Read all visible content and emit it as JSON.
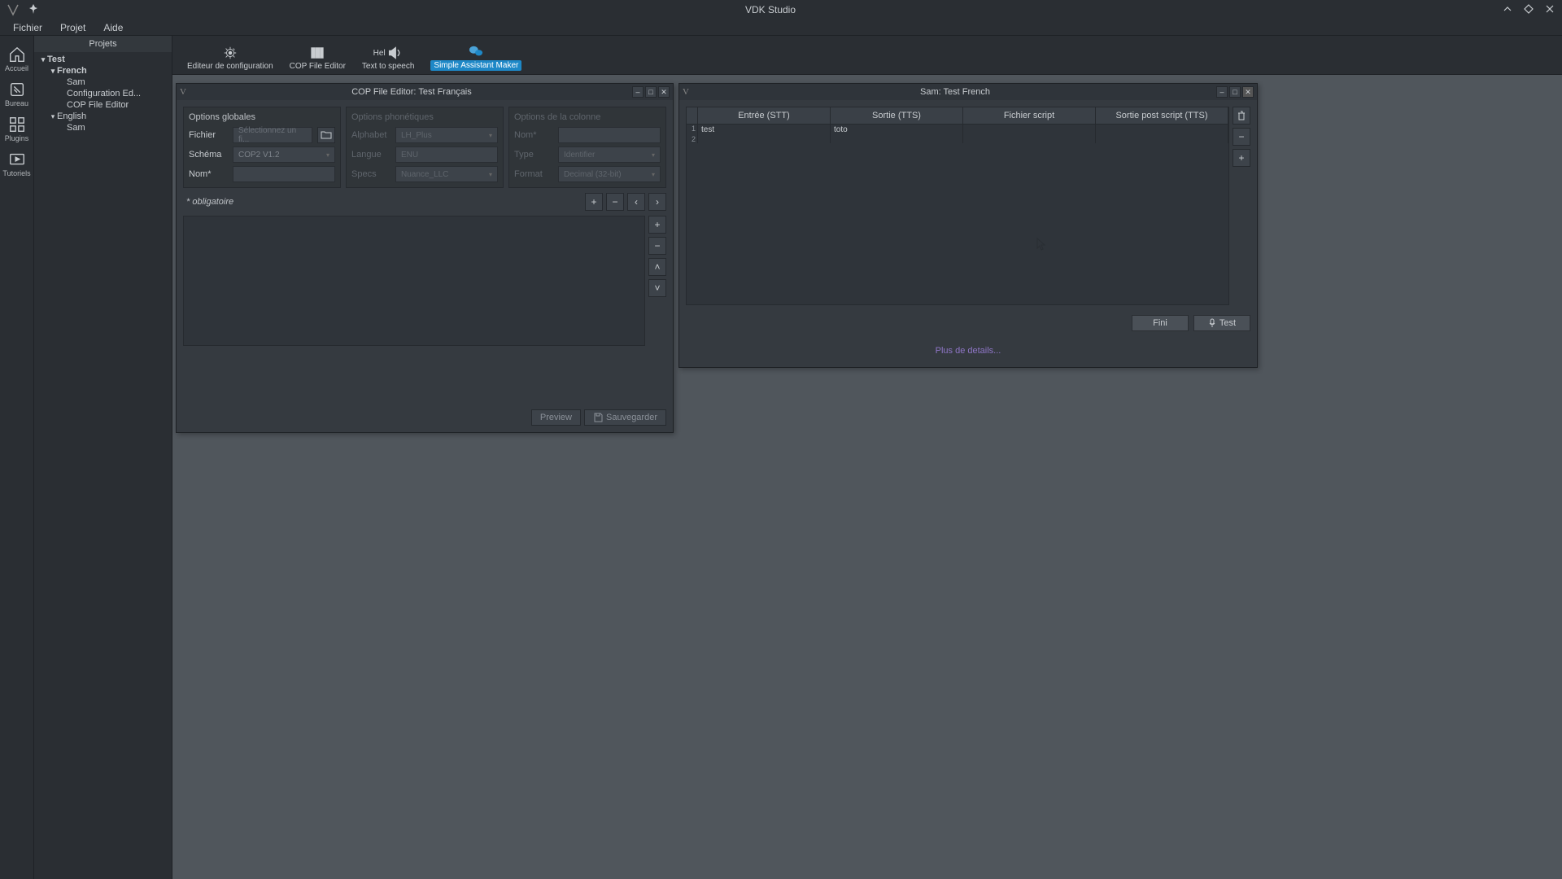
{
  "app": {
    "title": "VDK Studio"
  },
  "menu": {
    "items": [
      "Fichier",
      "Projet",
      "Aide"
    ]
  },
  "activity": {
    "items": [
      {
        "id": "home",
        "label": "Accueil"
      },
      {
        "id": "desk",
        "label": "Bureau"
      },
      {
        "id": "plugins",
        "label": "Plugins"
      },
      {
        "id": "tutorials",
        "label": "Tutoriels"
      }
    ]
  },
  "sidepanel": {
    "title": "Projets",
    "tree": [
      {
        "depth": 0,
        "label": "Test",
        "expand": true,
        "bold": true
      },
      {
        "depth": 1,
        "label": "French",
        "expand": true,
        "bold": true
      },
      {
        "depth": 2,
        "label": "Sam"
      },
      {
        "depth": 2,
        "label": "Configuration Ed..."
      },
      {
        "depth": 2,
        "label": "COP File Editor"
      },
      {
        "depth": 1,
        "label": "English",
        "expand": true
      },
      {
        "depth": 2,
        "label": "Sam"
      }
    ]
  },
  "toolbar": {
    "items": [
      {
        "id": "config",
        "label": "Editeur de configuration"
      },
      {
        "id": "cop",
        "label": "COP File Editor"
      },
      {
        "id": "tts",
        "label": "Text to speech",
        "badge": "Hel"
      },
      {
        "id": "sam",
        "label": "Simple Assistant Maker",
        "selected": true
      }
    ]
  },
  "winCop": {
    "title": "COP File Editor: Test Français",
    "groups": {
      "global": {
        "title": "Options globales",
        "fields": {
          "fichier_label": "Fichier",
          "fichier_placeholder": "Sélectionnez un fi...",
          "schema_label": "Schéma",
          "schema_value": "COP2 V1.2",
          "nom_label": "Nom*"
        }
      },
      "phon": {
        "title": "Options phonétiques",
        "fields": {
          "alphabet_label": "Alphabet",
          "alphabet_value": "LH_Plus",
          "langue_label": "Langue",
          "langue_value": "ENU",
          "specs_label": "Specs",
          "specs_value": "Nuance_LLC"
        }
      },
      "col": {
        "title": "Options de la colonne",
        "fields": {
          "nom_label": "Nom*",
          "type_label": "Type",
          "type_value": "Identifier",
          "format_label": "Format",
          "format_value": "Decimal (32-bit)"
        }
      }
    },
    "mandatory": "* obligatoire",
    "buttons": {
      "preview": "Preview",
      "save": "Sauvegarder"
    }
  },
  "winSam": {
    "title": "Sam: Test French",
    "columns": [
      "Entrée (STT)",
      "Sortie (TTS)",
      "Fichier script",
      "Sortie post script (TTS)"
    ],
    "rows": [
      {
        "num": "1",
        "cells": [
          "test",
          "toto",
          "",
          ""
        ]
      },
      {
        "num": "2",
        "cells": [
          "",
          "",
          "",
          ""
        ]
      }
    ],
    "buttons": {
      "fini": "Fini",
      "test": "Test"
    },
    "more": "Plus de details..."
  }
}
